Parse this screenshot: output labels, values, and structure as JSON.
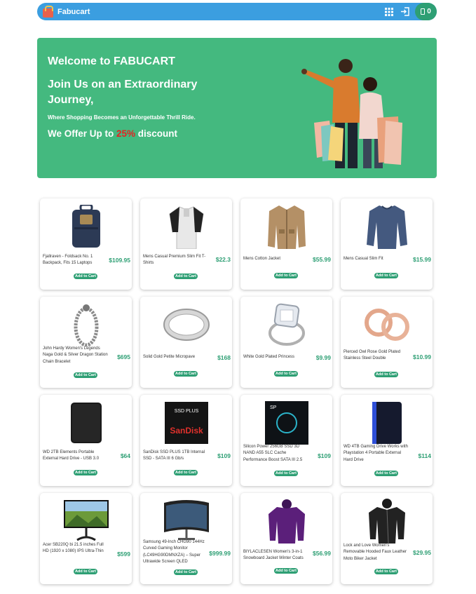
{
  "header": {
    "brand": "Fabucart",
    "icons": [
      "grid-icon",
      "login-icon",
      "cart-icon"
    ],
    "cart_count": "0",
    "colors": {
      "bar": "#3b9ee0",
      "cart": "#2e9f74"
    }
  },
  "hero": {
    "welcome": "Welcome to FABUCART",
    "headline": "Join Us on an Extraordinary Journey,",
    "tagline": "Where Shopping Becomes an Unforgettable Thrill Ride.",
    "offer_prefix": "We Offer Up to ",
    "offer_percent": "25%",
    "offer_suffix": " discount",
    "bg_color": "#44b97f"
  },
  "add_label": "Add to Cart",
  "products": [
    {
      "title": "Fjallraven - Foldsack No. 1 Backpack, Fits 15 Laptops",
      "price": "$109.95",
      "icon": "backpack-icon"
    },
    {
      "title": "Mens Casual Premium Slim Fit T-Shirts",
      "price": "$22.3",
      "icon": "tshirt-icon"
    },
    {
      "title": "Mens Cotton Jacket",
      "price": "$55.99",
      "icon": "jacket-icon"
    },
    {
      "title": "Mens Casual Slim Fit",
      "price": "$15.99",
      "icon": "longsleeve-icon"
    },
    {
      "title": "John Hardy Women's Legends Naga Gold & Silver Dragon Station Chain Bracelet",
      "price": "$695",
      "icon": "bracelet-icon"
    },
    {
      "title": "Solid Gold Petite Micropave",
      "price": "$168",
      "icon": "ring-icon"
    },
    {
      "title": "White Gold Plated Princess",
      "price": "$9.99",
      "icon": "diamond-ring-icon"
    },
    {
      "title": "Pierced Owl Rose Gold Plated Stainless Steel Double",
      "price": "$10.99",
      "icon": "earrings-icon"
    },
    {
      "title": "WD 2TB Elements Portable External Hard Drive - USB 3.0",
      "price": "$64",
      "icon": "hard-drive-icon"
    },
    {
      "title": "SanDisk SSD PLUS 1TB Internal SSD - SATA III 6 Gb/s",
      "price": "$109",
      "icon": "ssd-icon"
    },
    {
      "title": "Silicon Power 256GB SSD 3D NAND A55 SLC Cache Performance Boost SATA III 2.5",
      "price": "$109",
      "icon": "ssd-box-icon"
    },
    {
      "title": "WD 4TB Gaming Drive Works with Playstation 4 Portable External Hard Drive",
      "price": "$114",
      "icon": "gaming-drive-icon"
    },
    {
      "title": "Acer SB220Q bi 21.5 inches Full HD (1920 x 1080) IPS Ultra-Thin",
      "price": "$599",
      "icon": "monitor-icon"
    },
    {
      "title": "Samsung 49-Inch CHG90 144Hz Curved Gaming Monitor (LC49HG90DMNXZA) – Super Ultrawide Screen QLED",
      "price": "$999.99",
      "icon": "curved-monitor-icon"
    },
    {
      "title": "BIYLACLESEN Women's 3-in-1 Snowboard Jacket Winter Coats",
      "price": "$56.99",
      "icon": "snow-jacket-icon"
    },
    {
      "title": "Lock and Love Women's Removable Hooded Faux Leather Moto Biker Jacket",
      "price": "$29.95",
      "icon": "leather-jacket-icon"
    }
  ]
}
